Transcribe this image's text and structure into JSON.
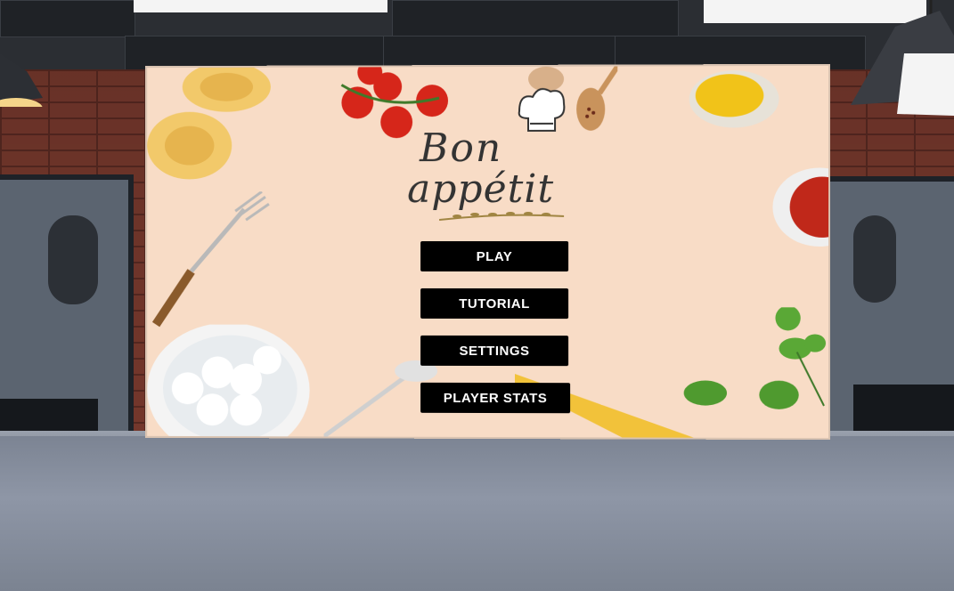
{
  "game": {
    "logo_text_line1": "Bon",
    "logo_text_line2": "appétit"
  },
  "menu": {
    "buttons": [
      {
        "label": "PLAY"
      },
      {
        "label": "TUTORIAL"
      },
      {
        "label": "SETTINGS"
      },
      {
        "label": "PLAYER STATS"
      }
    ]
  },
  "colors": {
    "button_bg": "#000000",
    "button_text": "#ffffff",
    "screen_bg": "#f8dcc6",
    "brick": "#7a3a2e"
  },
  "icons": [
    "chef-hat-icon",
    "fork-icon",
    "spoon-icon",
    "tomato-icon",
    "basil-icon"
  ]
}
